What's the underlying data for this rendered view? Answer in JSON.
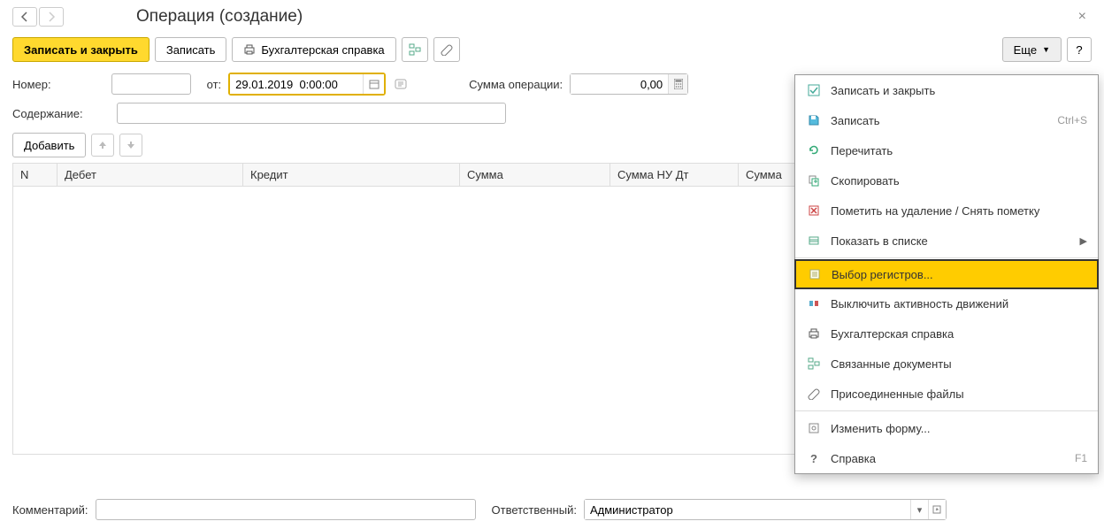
{
  "header": {
    "title": "Операция (создание)"
  },
  "toolbar": {
    "save_close": "Записать и закрыть",
    "save": "Записать",
    "accounting_ref": "Бухгалтерская справка",
    "more": "Еще",
    "help": "?"
  },
  "form": {
    "number_label": "Номер:",
    "number_value": "",
    "from_label": "от:",
    "date_value": "29.01.2019  0:00:00",
    "amount_label": "Сумма операции:",
    "amount_value": "0,00",
    "content_label": "Содержание:",
    "content_value": ""
  },
  "table_toolbar": {
    "add": "Добавить"
  },
  "columns": {
    "n": "N",
    "debit": "Дебет",
    "credit": "Кредит",
    "sum": "Сумма",
    "sumnu_dt": "Сумма НУ Дт",
    "sum2": "Сумма"
  },
  "footer": {
    "comment_label": "Комментарий:",
    "comment_value": "",
    "responsible_label": "Ответственный:",
    "responsible_value": "Администратор"
  },
  "menu": {
    "items": [
      {
        "label": "Записать и закрыть",
        "icon": "save-close"
      },
      {
        "label": "Записать",
        "icon": "save",
        "shortcut": "Ctrl+S"
      },
      {
        "label": "Перечитать",
        "icon": "refresh"
      },
      {
        "label": "Скопировать",
        "icon": "copy"
      },
      {
        "label": "Пометить на удаление / Снять пометку",
        "icon": "delete-mark"
      },
      {
        "label": "Показать в списке",
        "icon": "list",
        "submenu": true
      },
      {
        "label": "Выбор регистров...",
        "icon": "registers",
        "highlight": true
      },
      {
        "label": "Выключить активность движений",
        "icon": "activity"
      },
      {
        "label": "Бухгалтерская справка",
        "icon": "print"
      },
      {
        "label": "Связанные документы",
        "icon": "related"
      },
      {
        "label": "Присоединенные файлы",
        "icon": "attach"
      },
      {
        "label": "Изменить форму...",
        "icon": "edit-form"
      },
      {
        "label": "Справка",
        "icon": "help",
        "shortcut": "F1"
      }
    ]
  }
}
